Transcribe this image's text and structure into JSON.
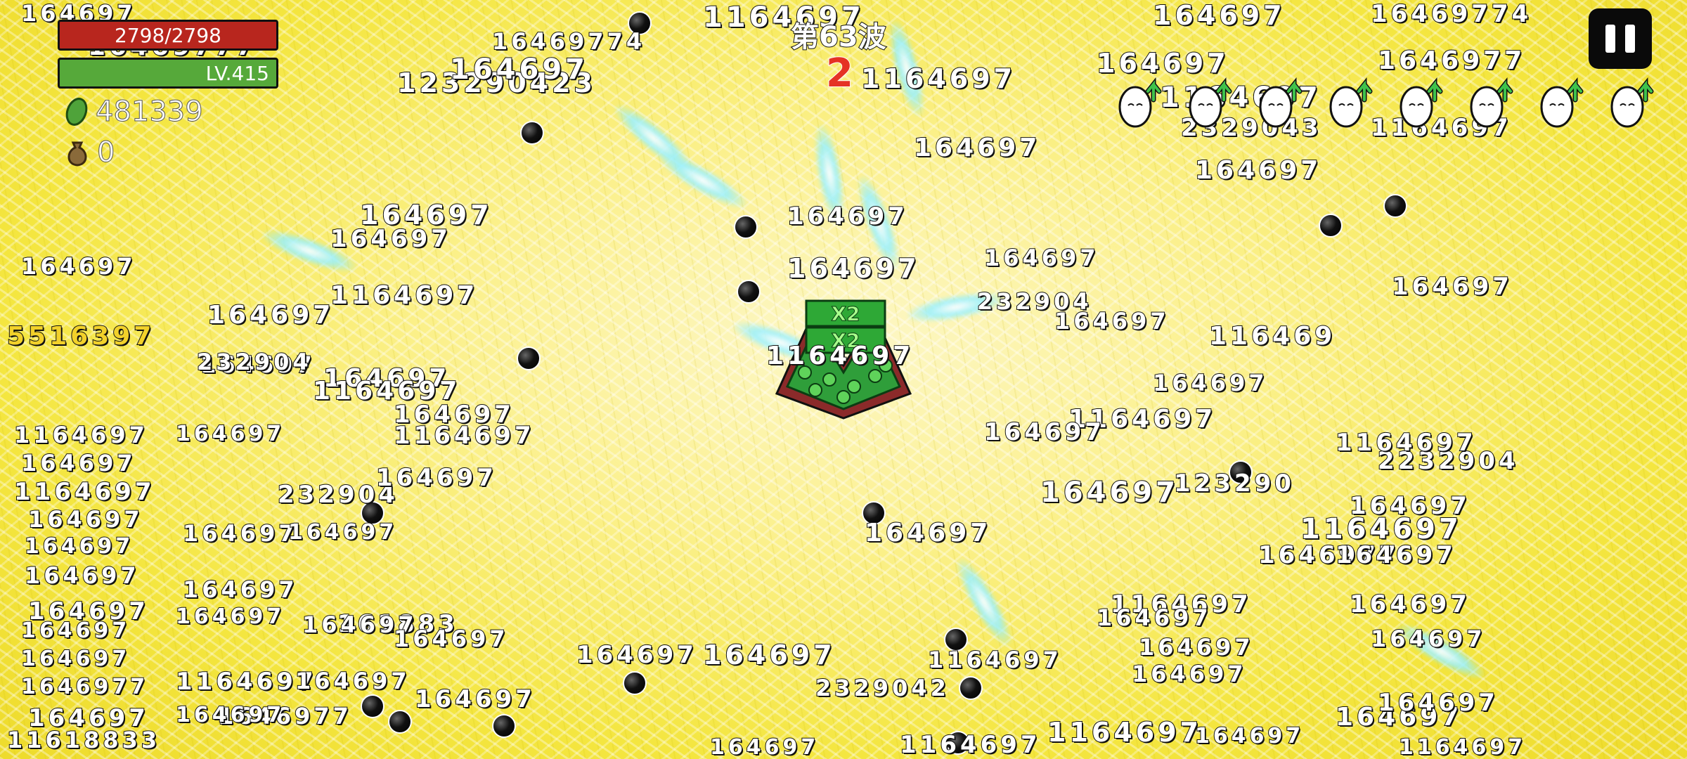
{
  "hud": {
    "hp": {
      "text": "2798/2798",
      "current": 2798,
      "max": 2798,
      "color": "#b8261e"
    },
    "level": {
      "text": "LV.415",
      "color": "#56a93a"
    },
    "gems": {
      "icon": "green-gem-icon",
      "value": "481339"
    },
    "bag": {
      "icon": "money-bag-icon",
      "value": "0"
    }
  },
  "wave": {
    "label": "第63波",
    "countdown": "2"
  },
  "pause_button": {
    "icon": "pause-icon"
  },
  "upgrades": {
    "count": 8,
    "icon": "egg-upgrade-arrow-icon"
  },
  "player": {
    "badges": [
      "X2",
      "X2"
    ]
  },
  "damage_numbers": [
    "164697",
    "1164697",
    "164697",
    "16469774",
    "16469777",
    "123290423",
    "164697",
    "1164697",
    "164697",
    "1164697",
    "16469774",
    "164697",
    "164697",
    "2329043",
    "1164697",
    "1646977",
    "164697",
    "164697",
    "164697",
    "164697",
    "1164697",
    "232904",
    "164697",
    "164697",
    "5516397",
    "232904",
    "164697",
    "116469",
    "164697",
    "164697",
    "1164697",
    "2232904",
    "11618833",
    "232904",
    "123290",
    "1164697",
    "164697",
    "164697",
    "164697",
    "164697",
    "161883",
    "1164697",
    "1164697",
    "164697",
    "164697",
    "164697",
    "1164697",
    "1646977",
    "164697",
    "1646977",
    "164697",
    "164697",
    "164697",
    "1164697",
    "164697",
    "1164697",
    "1164697",
    "2329042",
    "1164697",
    "164697",
    "164697",
    "164697",
    "164697",
    "164697",
    "1164697",
    "164697",
    "164697",
    "164697",
    "164697",
    "164697",
    "1164697",
    "1164697",
    "164697",
    "1164697",
    "164697",
    "164697",
    "164697",
    "164697",
    "164697",
    "164697",
    "1646977",
    "164697",
    "164697",
    "164697",
    "164697",
    "164697",
    "164697",
    "164697",
    "1164697",
    "164697",
    "164697",
    "164697"
  ]
}
